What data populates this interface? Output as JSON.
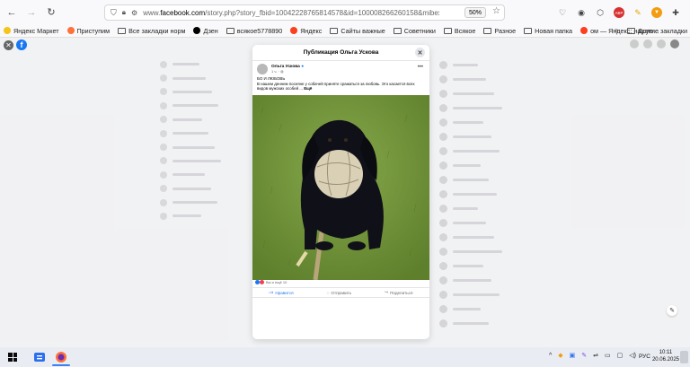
{
  "browser": {
    "url_prefix": "www.",
    "url_domain": "facebook.com",
    "url_rest": "/story.php?story_fbid=10042228765814578&id=100008266260158&mibextid=...",
    "zoom": "50%"
  },
  "bookmarks": [
    {
      "label": "Яндекс Маркет",
      "icon": "yandex-market-icon",
      "color": "#f5c518"
    },
    {
      "label": "Приступим",
      "icon": "firefox-icon",
      "color": "#ff7139"
    },
    {
      "label": "Все закладки норм",
      "icon": "folder-icon",
      "color": ""
    },
    {
      "label": "Дзен",
      "icon": "dzen-icon",
      "color": "#000000"
    },
    {
      "label": "всякое5778890",
      "icon": "folder-icon",
      "color": ""
    },
    {
      "label": "Яндекс",
      "icon": "yandex-icon",
      "color": "#fc3f1d"
    },
    {
      "label": "Сайты важные",
      "icon": "folder-icon",
      "color": ""
    },
    {
      "label": "Советники",
      "icon": "folder-icon",
      "color": ""
    },
    {
      "label": "Всякое",
      "icon": "folder-icon",
      "color": ""
    },
    {
      "label": "Разное",
      "icon": "folder-icon",
      "color": ""
    },
    {
      "label": "Новая папка",
      "icon": "folder-icon",
      "color": ""
    },
    {
      "label": "ом — Яндекс: нашло...",
      "icon": "yandex-icon",
      "color": "#fc3f1d"
    }
  ],
  "bookmarks_more": "»",
  "bookmarks_other": "Другие закладки",
  "modal": {
    "title": "Публикация Ольга Ускова",
    "author": "Ольга Ускова",
    "time": "1 ч. · ",
    "text_1": "БО И ЛЮБОВЬ",
    "text_2": "В нашем деннем посеяне у собачей приняте сражаться за любовь. Это касается всех видов мужских особей ...",
    "more": "Ещё",
    "reactions": "Вы и ещё 10",
    "actions": [
      {
        "label": "Нравится",
        "icon": "like-icon"
      },
      {
        "label": "Отправить",
        "icon": "messenger-icon"
      },
      {
        "label": "Поделиться",
        "icon": "share-icon"
      }
    ]
  },
  "sidebar_faded_count": 12,
  "taskbar": {
    "lang": "РУС",
    "time": "10:11",
    "date": "20.06.2025"
  },
  "colors": {
    "facebook_blue": "#1877f2",
    "taskbar": "#e9ecf2",
    "toolbar": "#f9f9fb"
  }
}
